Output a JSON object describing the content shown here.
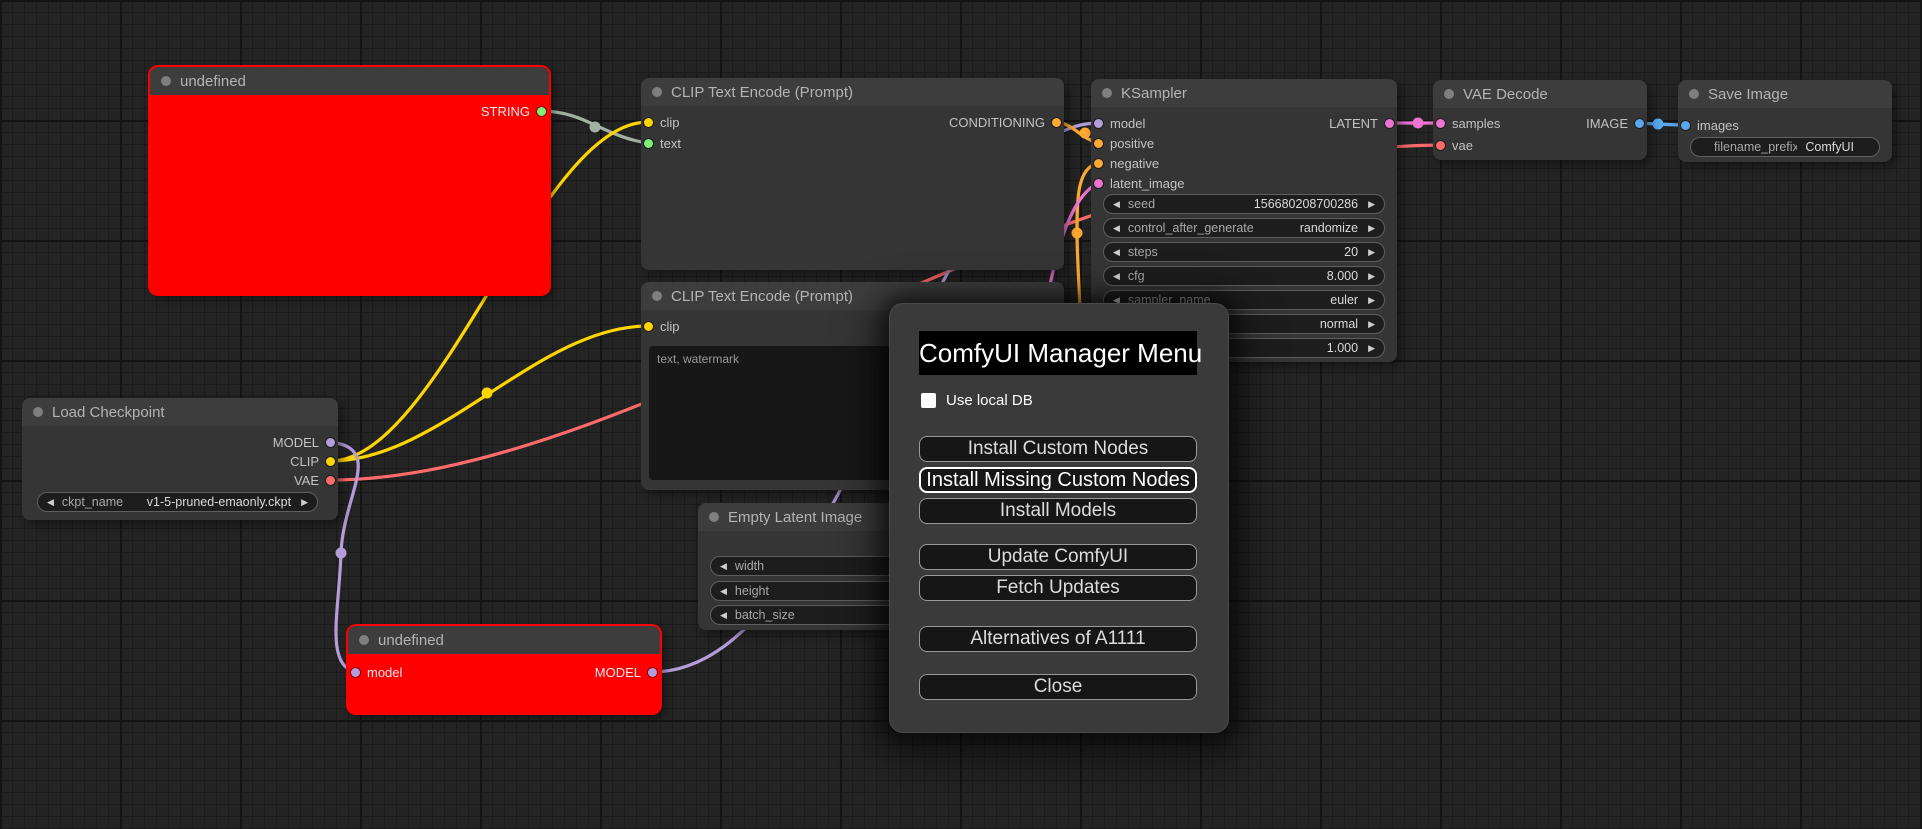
{
  "colors": {
    "model": "#b39ddb",
    "clip": "#ffd500",
    "vae": "#ff6b6b",
    "conditioning": "#ffa931",
    "latent": "#ec73d0",
    "image": "#5aa7f0",
    "string": "#7cf178",
    "string_wire": "#a3b1a3",
    "error": "#ff0000"
  },
  "nodes": [
    {
      "title": "undefined",
      "outputs": [
        "STRING"
      ]
    },
    {
      "title": "CLIP Text Encode (Prompt)",
      "inputs": [
        "clip",
        "text"
      ],
      "outputs": [
        "CONDITIONING"
      ]
    },
    {
      "title": "KSampler",
      "inputs": [
        "model",
        "positive",
        "negative",
        "latent_image"
      ],
      "outputs": [
        "LATENT"
      ],
      "widgets": [
        {
          "label": "seed",
          "value": "156680208700286"
        },
        {
          "label": "control_after_generate",
          "value": "randomize"
        },
        {
          "label": "steps",
          "value": "20"
        },
        {
          "label": "cfg",
          "value": "8.000"
        },
        {
          "label": "sampler_name",
          "value": "euler"
        },
        {
          "label": "",
          "value": "normal"
        },
        {
          "label": "",
          "value": "1.000"
        }
      ]
    },
    {
      "title": "VAE Decode",
      "inputs": [
        "samples",
        "vae"
      ],
      "outputs": [
        "IMAGE"
      ]
    },
    {
      "title": "Save Image",
      "inputs": [
        "images"
      ],
      "widgets": [
        {
          "label": "filename_prefix",
          "value": "ComfyUI"
        }
      ]
    },
    {
      "title": "CLIP Text Encode (Prompt)",
      "inputs": [
        "clip"
      ],
      "prompt_text": "text, watermark"
    },
    {
      "title": "Empty Latent Image",
      "widgets": [
        {
          "label": "width",
          "value": ""
        },
        {
          "label": "height",
          "value": ""
        },
        {
          "label": "batch_size",
          "value": ""
        }
      ]
    },
    {
      "title": "undefined",
      "inputs": [
        "model"
      ],
      "outputs": [
        "MODEL"
      ]
    },
    {
      "title": "Load Checkpoint",
      "outputs": [
        "MODEL",
        "CLIP",
        "VAE"
      ],
      "widgets": [
        {
          "label": "ckpt_name",
          "value": "v1-5-pruned-emaonly.ckpt"
        }
      ]
    }
  ],
  "dialog": {
    "title": "ComfyUI Manager Menu",
    "checkbox_label": "Use local DB",
    "buttons": [
      "Install Custom Nodes",
      "Install Missing Custom Nodes",
      "Install Models",
      "Update ComfyUI",
      "Fetch Updates",
      "Alternatives of A1111",
      "Close"
    ]
  }
}
